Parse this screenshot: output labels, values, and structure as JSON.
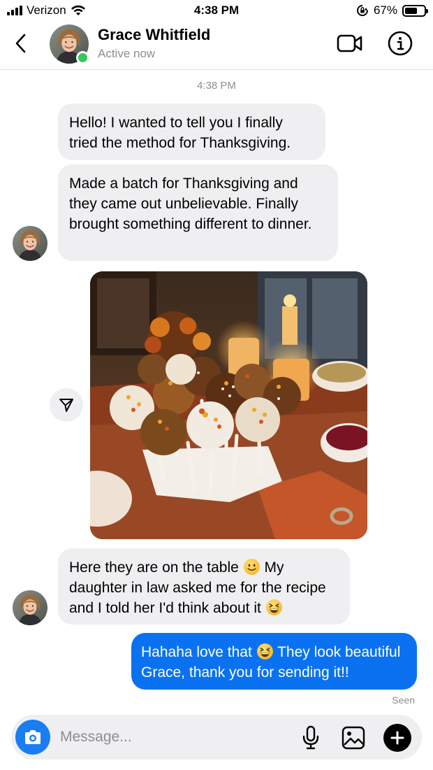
{
  "status_bar": {
    "carrier": "Verizon",
    "time": "4:38 PM",
    "battery": "67%",
    "battery_level": 0.67,
    "icons": [
      "signal-icon",
      "wifi-icon",
      "rotation-lock-icon",
      "battery-icon"
    ]
  },
  "header": {
    "contact_name": "Grace Whitfield",
    "status": "Active now",
    "icons": [
      "back-chevron-icon",
      "video-call-icon",
      "info-icon"
    ]
  },
  "conversation": {
    "timestamp": "4:38 PM",
    "messages": [
      {
        "from": "contact",
        "type": "text",
        "text": "Hello! I wanted to tell you I finally tried the method for Thanksgiving."
      },
      {
        "from": "contact",
        "type": "text",
        "text": "Made a batch for Thanksgiving and they came out unbelievable. Finally brought something different to dinner."
      },
      {
        "from": "contact",
        "type": "photo",
        "icon": "share-icon"
      },
      {
        "from": "contact",
        "type": "text",
        "text_a": "Here they are on the table",
        "text_b": "My daughter in law asked me for the recipe and I told her I'd think about it",
        "emojis": [
          "slightly-smiling-face",
          "grinning-squinting-face"
        ]
      },
      {
        "from": "me",
        "type": "text",
        "text_a": "Hahaha love that",
        "text_b": "They look beautiful Grace, thank you for sending it!!",
        "emojis": [
          "grinning-squinting-face"
        ]
      }
    ],
    "seen_label": "Seen"
  },
  "composer": {
    "placeholder": "Message...",
    "icons": [
      "camera-icon",
      "microphone-icon",
      "gallery-icon",
      "plus-icon"
    ]
  },
  "colors": {
    "outgoing_bubble": "#0a72f0",
    "incoming_bubble": "#efeff1",
    "online": "#34c759",
    "camera_button": "#1a7ef2",
    "muted_text": "#8e8e8e"
  }
}
